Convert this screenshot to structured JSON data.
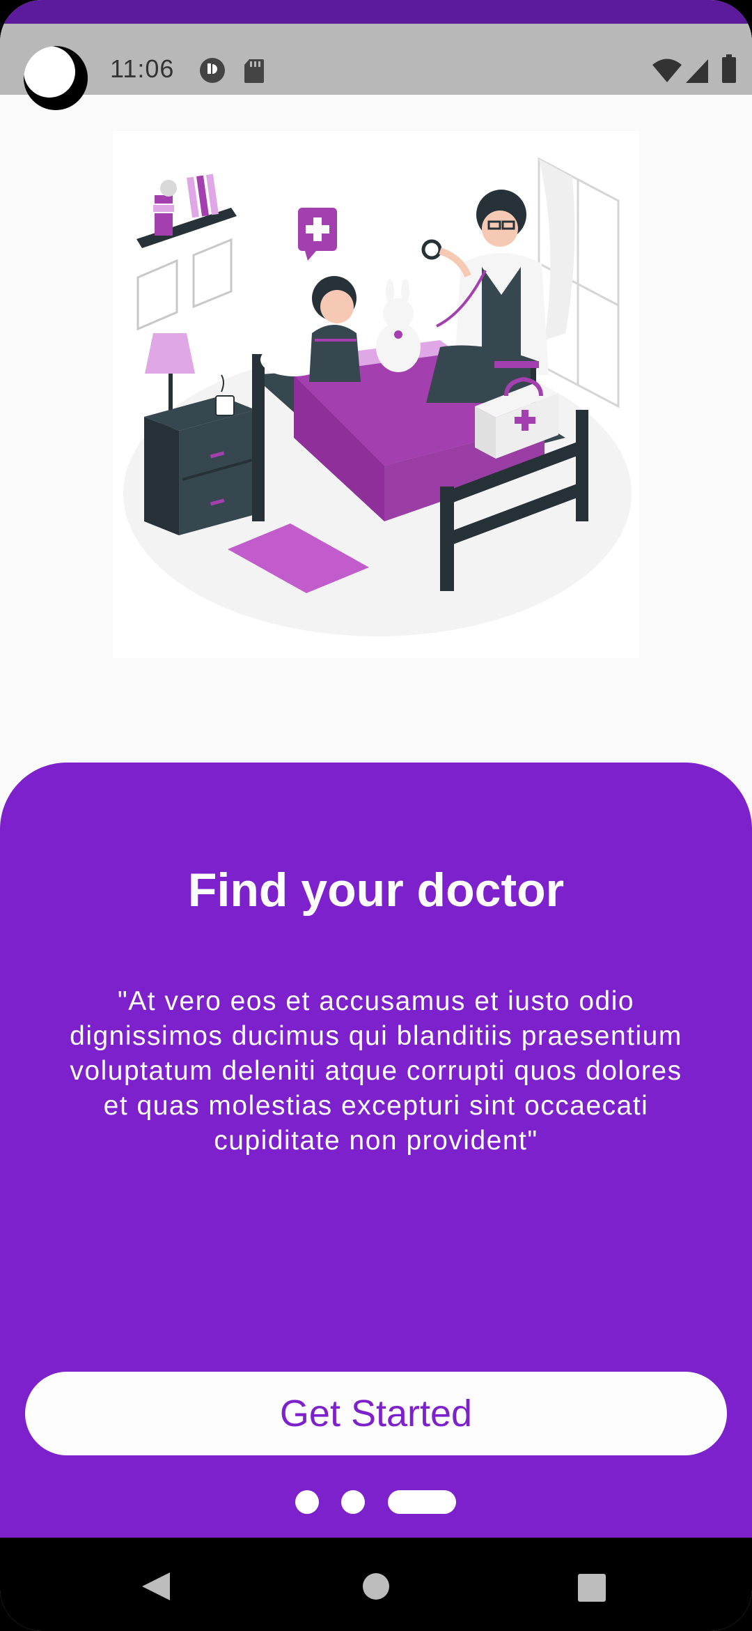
{
  "status_bar": {
    "time": "11:06",
    "icons": [
      "notification-icon",
      "sd-card-icon",
      "wifi-icon",
      "signal-icon",
      "battery-icon"
    ]
  },
  "illustration": {
    "icon": "doctor-visit-illustration"
  },
  "onboarding": {
    "title": "Find your doctor",
    "description": "\"At vero eos et accusamus et iusto odio dignissimos ducimus qui blanditiis praesentium voluptatum deleniti atque corrupti quos dolores et quas molestias excepturi sint occaecati cupiditate non provident\"",
    "button_label": "Get Started",
    "page_indicator": {
      "total": 3,
      "current": 3
    }
  },
  "navigation": {
    "items": [
      "back-icon",
      "home-icon",
      "recents-icon"
    ]
  },
  "colors": {
    "accent": "#7d21cd",
    "top_strip": "#5c1a9c",
    "status_bar": "#b8b8b8",
    "background": "#fafafa",
    "button_background": "#fdfdfd",
    "illustration_purple": "#a33fae"
  }
}
